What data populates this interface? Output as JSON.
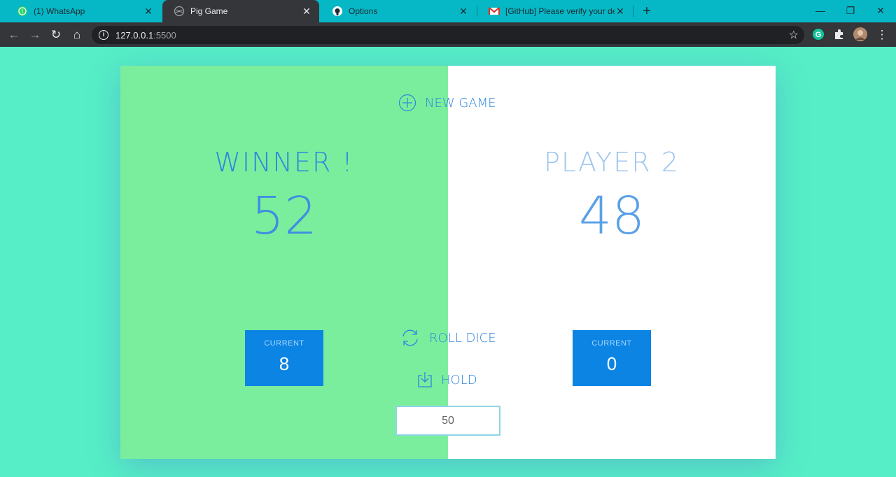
{
  "browser": {
    "tabs": [
      {
        "title": "(1) WhatsApp",
        "icon": "whatsapp-icon",
        "active": false
      },
      {
        "title": "Pig Game",
        "icon": "globe-icon",
        "active": true
      },
      {
        "title": "Options",
        "icon": "github-icon",
        "active": false
      },
      {
        "title": "[GitHub] Please verify your device",
        "icon": "gmail-icon",
        "active": false
      }
    ],
    "url_host": "127.0.0.1",
    "url_port": ":5500"
  },
  "game": {
    "new_game_label": "NEW GAME",
    "roll_dice_label": "ROLL DICE",
    "hold_label": "HOLD",
    "target_score": "50",
    "players": [
      {
        "name": "WINNER !",
        "score": "52",
        "current_label": "CURRENT",
        "current_score": "8"
      },
      {
        "name": "PLAYER 2",
        "score": "48",
        "current_label": "CURRENT",
        "current_score": "0"
      }
    ]
  },
  "colors": {
    "page_bg": "#55eec6",
    "winner_panel": "#7bee9e",
    "inactive_panel": "#ffffff",
    "accent_blue": "#0b84e3",
    "tab_strip": "#06b8c6"
  }
}
